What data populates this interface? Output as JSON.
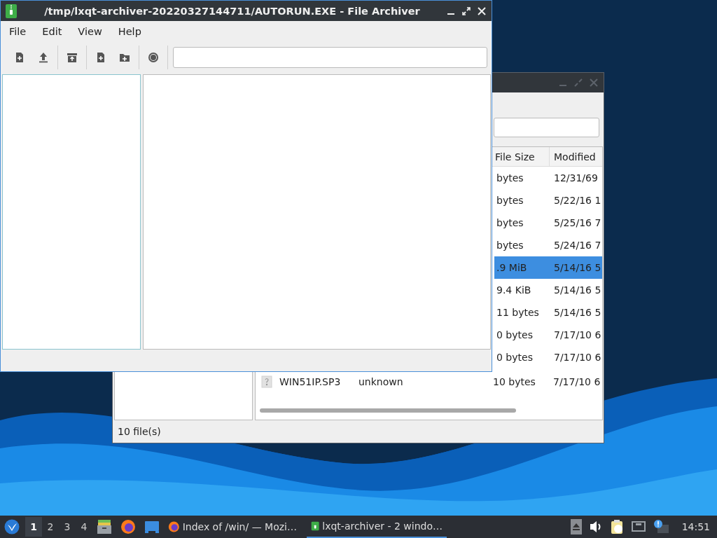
{
  "front_window": {
    "title": "/tmp/lxqt-archiver-20220327144711/AUTORUN.EXE - File Archiver",
    "menu": [
      "File",
      "Edit",
      "View",
      "Help"
    ]
  },
  "back_window": {
    "columns": [
      "File Size",
      "Modified"
    ],
    "rows": [
      {
        "size": "bytes",
        "modified": "12/31/69",
        "selected": false
      },
      {
        "size": "bytes",
        "modified": "5/22/16 1",
        "selected": false
      },
      {
        "size": "bytes",
        "modified": "5/25/16 7",
        "selected": false
      },
      {
        "size": "bytes",
        "modified": "5/24/16 7",
        "selected": false
      },
      {
        "size": ".9 MiB",
        "modified": "5/14/16 5",
        "selected": true
      },
      {
        "size": "9.4 KiB",
        "modified": "5/14/16 5",
        "selected": false
      },
      {
        "size": "11 bytes",
        "modified": "5/14/16 5",
        "selected": false
      },
      {
        "size": "0 bytes",
        "modified": "7/17/10 6",
        "selected": false
      },
      {
        "size": "0 bytes",
        "modified": "7/17/10 6",
        "selected": false
      },
      {
        "name": "WIN51IP.SP3",
        "type": "unknown",
        "size": "10 bytes",
        "modified": "7/17/10 6",
        "selected": false
      }
    ],
    "status": "10 file(s)"
  },
  "taskbar": {
    "desktops": [
      {
        "label": "1",
        "selected": true
      },
      {
        "label": "2",
        "selected": false
      },
      {
        "label": "3",
        "selected": false
      },
      {
        "label": "4",
        "selected": false
      }
    ],
    "tasks": [
      {
        "label": "Index of /win/ — Mozi…",
        "kind": "browser",
        "selected": false
      },
      {
        "label": "lxqt-archiver - 2 windo…",
        "kind": "archiver",
        "selected": true
      }
    ],
    "clock": "14:51"
  }
}
